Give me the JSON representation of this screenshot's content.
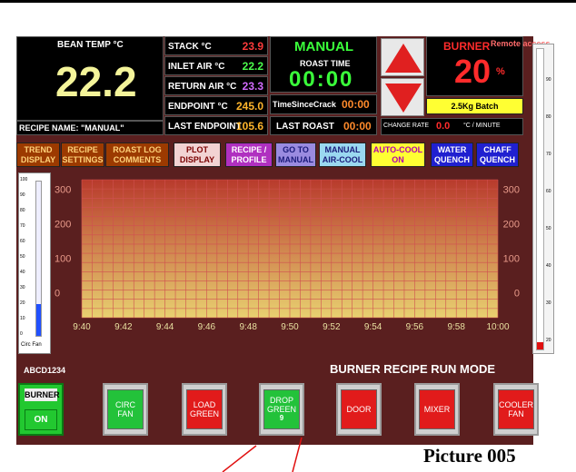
{
  "remote_access": "Remote access",
  "bean_temp": {
    "label": "BEAN TEMP °C",
    "value": "22.2"
  },
  "recipe_name": "RECIPE NAME: \"MANUAL\"",
  "readouts": [
    {
      "label": "STACK °C",
      "value": "23.9",
      "color": "#ff3b3b"
    },
    {
      "label": "INLET AIR °C",
      "value": "22.2",
      "color": "#4cff4c"
    },
    {
      "label": "RETURN AIR °C",
      "value": "23.3",
      "color": "#d36bff"
    },
    {
      "label": "ENDPOINT °C",
      "value": "245.0",
      "color": "#ffb52b"
    },
    {
      "label": "LAST ENDPOINT",
      "value": "105.6",
      "color": "#ffb52b"
    }
  ],
  "mode": {
    "label": "MANUAL",
    "roast_time_label": "ROAST TIME",
    "roast_time": "00:00"
  },
  "time_since_crack": {
    "label": "TimeSinceCrack",
    "value": "00:00"
  },
  "last_roast": {
    "label": "LAST ROAST",
    "value": "00:00"
  },
  "burner": {
    "label": "BURNER",
    "value": "20",
    "unit": "%"
  },
  "batch": "2.5Kg Batch",
  "change_rate": {
    "label": "CHANGE RATE",
    "value": "0.0",
    "unit": "°C / MINUTE"
  },
  "nav_buttons": [
    {
      "label": "TREND DISPLAY",
      "bg": "#9c3a00",
      "fg": "#ffd27a"
    },
    {
      "label": "RECIPE SETTINGS",
      "bg": "#9c3a00",
      "fg": "#ffd27a"
    },
    {
      "label": "ROAST LOG COMMENTS",
      "bg": "#9c3a00",
      "fg": "#ffd27a"
    },
    {
      "label": "PLOT DISPLAY",
      "bg": "#f2d3d3",
      "fg": "#7a0000"
    },
    {
      "label": "RECIPE / PROFILE",
      "bg": "#b030c0",
      "fg": "#ffffff"
    },
    {
      "label": "GO TO MANUAL",
      "bg": "#9a8be0",
      "fg": "#1a1a7a"
    },
    {
      "label": "MANUAL AIR-COOL",
      "bg": "#9ad8f0",
      "fg": "#1a1a7a"
    },
    {
      "label": "AUTO-COOL ON",
      "bg": "#ffff33",
      "fg": "#b000b0"
    },
    {
      "label": "WATER QUENCH",
      "bg": "#2020d0",
      "fg": "#ffffff"
    },
    {
      "label": "CHAFF QUENCH",
      "bg": "#2020d0",
      "fg": "#ffffff"
    }
  ],
  "chart": {
    "y_ticks": [
      "300",
      "200",
      "100",
      "0"
    ],
    "x_ticks": [
      "9:40",
      "9:42",
      "9:44",
      "9:46",
      "9:48",
      "9:50",
      "9:52",
      "9:54",
      "9:56",
      "9:58",
      "10:00"
    ]
  },
  "left_gauge": {
    "ticks": [
      "100",
      "90",
      "80",
      "70",
      "60",
      "50",
      "40",
      "30",
      "20",
      "10",
      "0"
    ],
    "label": "Circ Fan"
  },
  "right_gauge": {
    "ticks": [
      "90",
      "80",
      "70",
      "60",
      "50",
      "40",
      "30",
      "20"
    ]
  },
  "machine_id": "ABCD1234",
  "run_mode": "BURNER RECIPE RUN MODE",
  "controls": [
    {
      "name": "burner",
      "top": "BURNER",
      "label": "ON"
    },
    {
      "name": "circ-fan",
      "label": "CIRC FAN",
      "color": "green"
    },
    {
      "name": "load-green",
      "label": "LOAD GREEN",
      "color": "red"
    },
    {
      "name": "drop-green",
      "label": "DROP GREEN",
      "sub": "9",
      "color": "green"
    },
    {
      "name": "door",
      "label": "DOOR",
      "color": "red"
    },
    {
      "name": "mixer",
      "label": "MIXER",
      "color": "red"
    },
    {
      "name": "cooler-fan",
      "label": "COOLER FAN",
      "color": "red"
    }
  ],
  "caption": "Picture 005"
}
